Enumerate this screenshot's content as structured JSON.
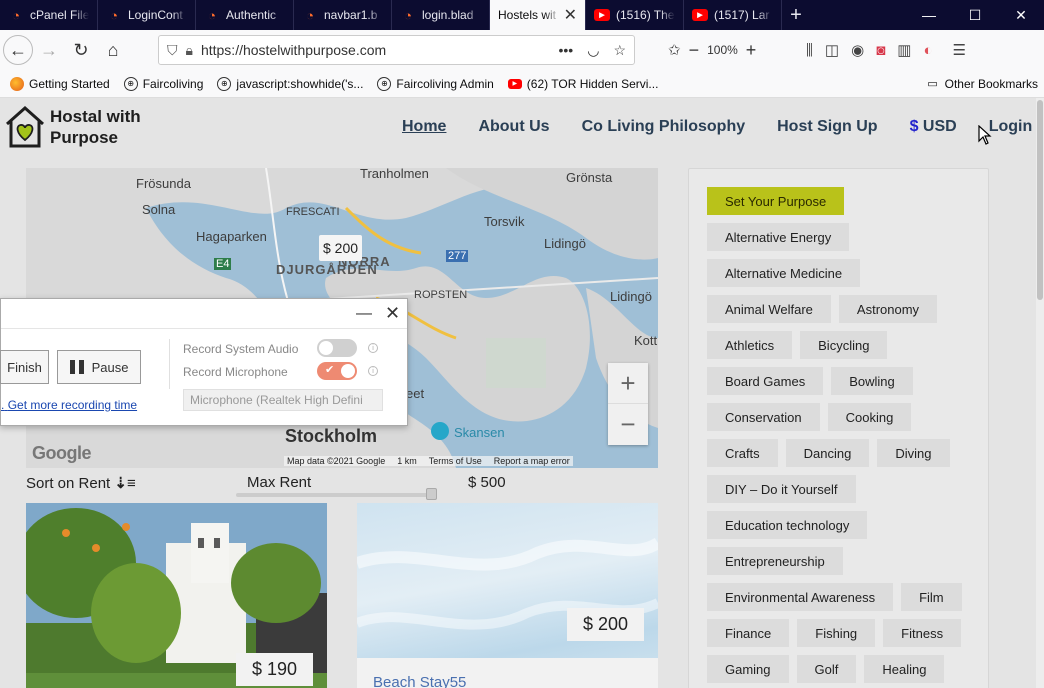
{
  "browser": {
    "tabs": [
      {
        "title": "cPanel File",
        "icon": "cpanel-icon"
      },
      {
        "title": "LoginCont",
        "icon": "cpanel-icon"
      },
      {
        "title": "Authentic",
        "icon": "cpanel-icon"
      },
      {
        "title": "navbar1.b",
        "icon": "cpanel-icon"
      },
      {
        "title": "login.blad",
        "icon": "cpanel-icon"
      },
      {
        "title": "Hostels wit",
        "icon": "",
        "active": true
      },
      {
        "title": "(1516) The",
        "icon": "youtube-icon"
      },
      {
        "title": "(1517) Lar",
        "icon": "youtube-icon"
      }
    ],
    "url": "https://hostelwithpurpose.com",
    "zoom": "100%",
    "bookmarks": [
      {
        "label": "Getting Started",
        "icon": "firefox-icon"
      },
      {
        "label": "Faircoliving",
        "icon": "globe-icon"
      },
      {
        "label": "javascript:showhide('s...",
        "icon": "globe-icon"
      },
      {
        "label": "Faircoliving Admin",
        "icon": "globe-icon"
      },
      {
        "label": "(62) TOR Hidden Servi...",
        "icon": "youtube-icon"
      }
    ],
    "other_bookmarks": "Other Bookmarks"
  },
  "site": {
    "logo_line1": "Hostal with",
    "logo_line2": "Purpose",
    "nav": {
      "home": "Home",
      "about": "About Us",
      "philosophy": "Co Living Philosophy",
      "host_signup": "Host Sign Up",
      "currency_symbol": "$",
      "currency": "USD",
      "login": "Login"
    },
    "map": {
      "labels": {
        "frosunda": "Frösunda",
        "solna": "Solna",
        "tranholmen": "Tranholmen",
        "gronsta": "Grönsta",
        "frescati": "FRESCATI",
        "hagaparken": "Hagaparken",
        "torsvik": "Torsvik",
        "lidingo1": "Lidingö",
        "norra": "NORRA",
        "djurgarden": "DJURGÅRDEN",
        "ropsten": "ROPSTEN",
        "lidingo2": "Lidingö",
        "kott": "Kott",
        "e4": "E4",
        "r277": "277",
        "stockholm": "Stockholm",
        "skansen": "Skansen",
        "eet": "eet"
      },
      "marker_price": "$ 200",
      "zoom_in": "+",
      "zoom_out": "−",
      "google": "Google",
      "attribution": {
        "data": "Map data ©2021 Google",
        "scale": "1 km",
        "terms": "Terms of Use",
        "report": "Report a map error"
      }
    },
    "filters": {
      "sort_label": "Sort on Rent",
      "max_rent_label": "Max Rent",
      "max_rent_value": "$ 500"
    },
    "listings": [
      {
        "price": "$ 190"
      },
      {
        "price": "$ 200",
        "title": "Beach Stay55"
      }
    ],
    "purposes": [
      "Set Your Purpose",
      "Alternative Energy",
      "Alternative Medicine",
      "Animal Welfare",
      "Astronomy",
      "Athletics",
      "Bicycling",
      "Board Games",
      "Bowling",
      "Conservation",
      "Cooking",
      "Crafts",
      "Dancing",
      "Diving",
      "DIY – Do it Yourself",
      "Education technology",
      "Entrepreneurship",
      "Environmental Awareness",
      "Film",
      "Finance",
      "Fishing",
      "Fitness",
      "Gaming",
      "Golf",
      "Healing"
    ]
  },
  "recorder": {
    "finish": "Finish",
    "pause": "Pause",
    "link_prefix": ".",
    "link": "Get more recording time",
    "system_audio": "Record System Audio",
    "microphone": "Record Microphone",
    "mic_device": "Microphone (Realtek High Defini",
    "system_audio_on": false,
    "microphone_on": true
  },
  "colors": {
    "tabbar": "#0c0c30",
    "accent_tag": "#b9c21a",
    "nav_text": "#2a3f55",
    "recorder_toggle_on": "#ee8a72"
  }
}
